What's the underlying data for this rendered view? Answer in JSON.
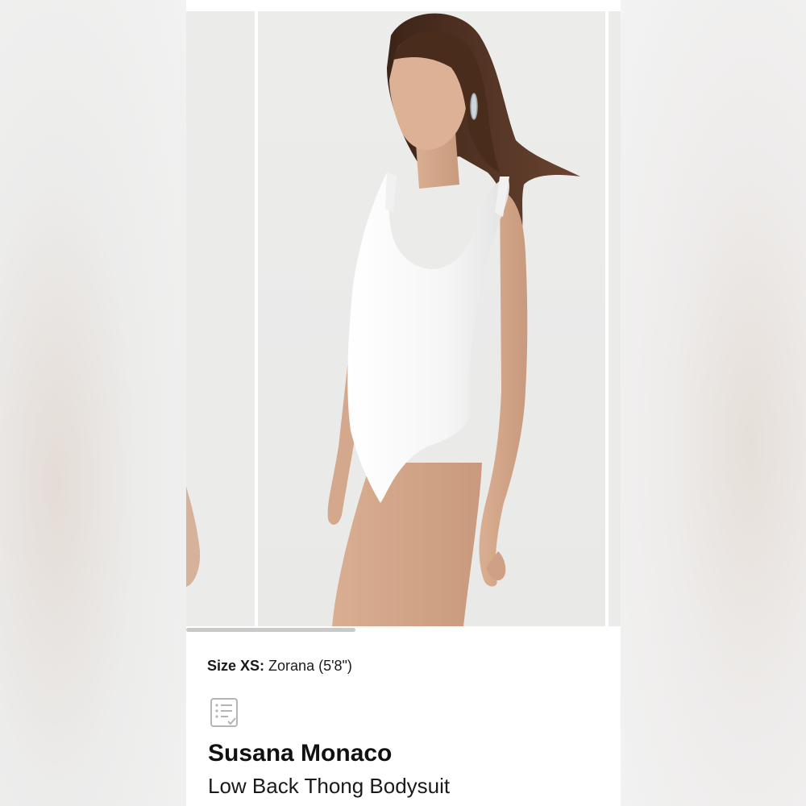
{
  "product_page": {
    "images": {
      "count_visible": 3,
      "selected_index": 1,
      "carousel_scroll_fraction": 0.39
    },
    "model_info": {
      "size_label": "Size XS:",
      "model_text": "Zorana (5'8\")"
    },
    "details_icon": "list-document-icon",
    "brand": "Susana Monaco",
    "product_name": "Low Back Thong Bodysuit"
  }
}
